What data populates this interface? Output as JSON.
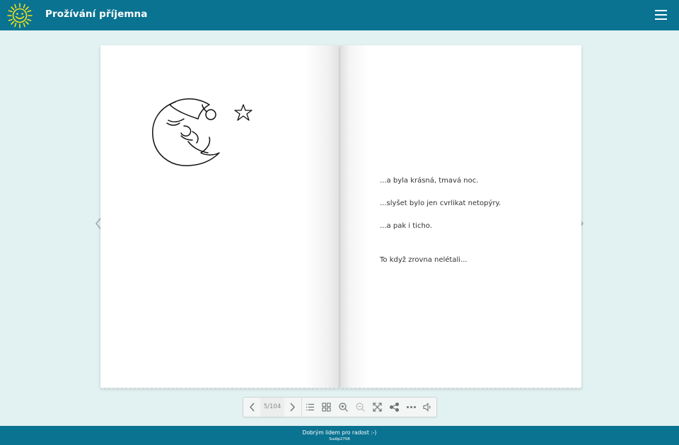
{
  "header": {
    "title": "Prožívání příjemna",
    "logo_icon": "sun-smiley-icon",
    "menu_icon": "hamburger-menu-icon"
  },
  "book": {
    "left_page": {
      "illustration": "moon-with-nightcap-and-star"
    },
    "right_page": {
      "lines": [
        "...a byla krásná, tmavá noc.",
        "...slyšet bylo jen cvrlikat netopýry.",
        "...a pak i ticho.",
        "To když zrovna nelétali..."
      ]
    }
  },
  "navigation": {
    "prev_icon": "chevron-left-icon",
    "next_icon": "chevron-right-icon"
  },
  "toolbar": {
    "page_counter": "5/104",
    "buttons": [
      "previous-page-icon",
      "next-page-icon",
      "table-of-contents-icon",
      "thumbnails-icon",
      "zoom-in-icon",
      "zoom-out-icon",
      "fullscreen-icon",
      "share-icon",
      "more-icon",
      "sound-icon"
    ]
  },
  "footer": {
    "text": "Dobrým lidem pro radost :-)",
    "code": "Sudip2708"
  },
  "colors": {
    "header_bg": "#0a7391",
    "page_bg": "#e2f1f1",
    "logo_yellow": "#f4e21a"
  }
}
